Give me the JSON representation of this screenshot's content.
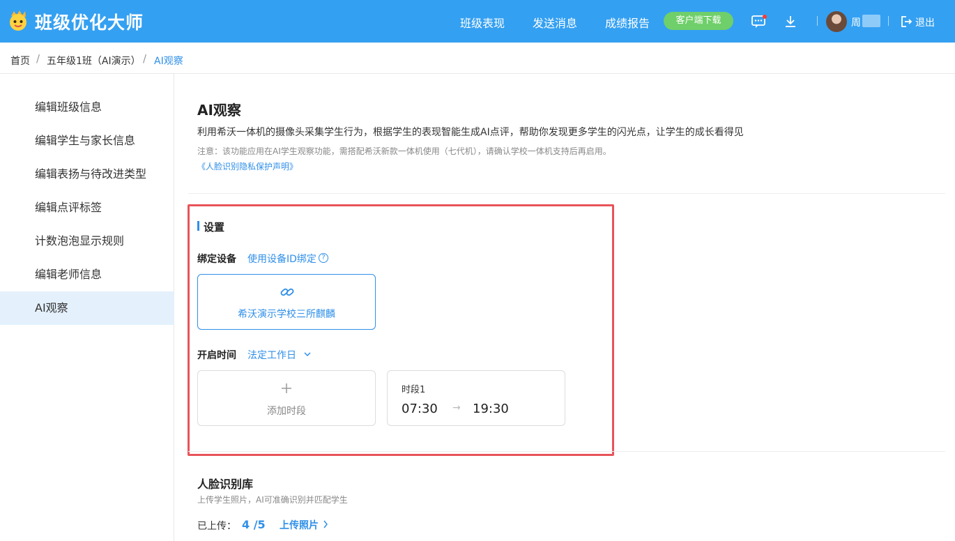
{
  "app": {
    "title": "班级优化大师"
  },
  "header": {
    "nav": [
      "班级表现",
      "发送消息",
      "成绩报告"
    ],
    "download_button": "客户端下载",
    "user_name": "周",
    "logout": "退出"
  },
  "breadcrumb": [
    "首页",
    "五年级1班（AI演示）",
    "AI观察"
  ],
  "sidebar": {
    "items": [
      {
        "label": "编辑班级信息"
      },
      {
        "label": "编辑学生与家长信息"
      },
      {
        "label": "编辑表扬与待改进类型"
      },
      {
        "label": "编辑点评标签"
      },
      {
        "label": "计数泡泡显示规则"
      },
      {
        "label": "编辑老师信息"
      },
      {
        "label": "AI观察"
      }
    ],
    "active_index": 6
  },
  "main": {
    "title": "AI观察",
    "description": "利用希沃一体机的摄像头采集学生行为，根据学生的表现智能生成AI点评，帮助你发现更多学生的闪光点，让学生的成长看得见",
    "note": "注意：该功能应用在AI学生观察功能，需搭配希沃新款一体机使用（七代机），请确认学校一体机支持后再启用。",
    "privacy_link": "《人脸识别隐私保护声明》",
    "settings": {
      "title": "设置",
      "bind_label": "绑定设备",
      "bind_by_id": "使用设备ID绑定",
      "device_name": "希沃演示学校三所麒麟",
      "open_time_label": "开启时间",
      "schedule_option": "法定工作日",
      "add_slot": "添加时段",
      "slots": [
        {
          "label": "时段1",
          "start": "07:30",
          "end": "19:30"
        }
      ]
    },
    "face_library": {
      "title": "人脸识别库",
      "description": "上传学生照片，AI可准确识别并匹配学生",
      "uploaded_label": "已上传：",
      "uploaded_count": "4 /5",
      "upload_link": "上传照片"
    }
  },
  "colors": {
    "primary": "#34a0f2",
    "link": "#2f8fe8",
    "highlight": "#e8535a",
    "download": "#6fcf6a"
  }
}
